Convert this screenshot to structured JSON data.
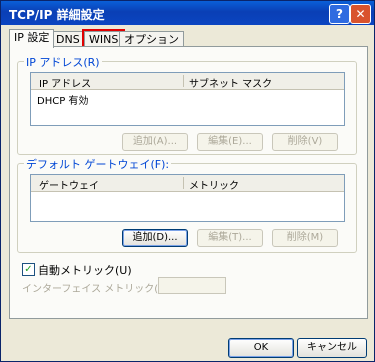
{
  "window": {
    "title": "TCP/IP 詳細設定",
    "help_icon": "?",
    "close_icon": "✕"
  },
  "tabs": [
    {
      "label": "IP 設定",
      "active": true
    },
    {
      "label": "DNS",
      "active": false
    },
    {
      "label": "WINS",
      "active": false,
      "highlighted": true
    },
    {
      "label": "オプション",
      "active": false
    }
  ],
  "ip_group": {
    "label": "IP アドレス(R)",
    "columns": [
      "IP アドレス",
      "サブネット マスク"
    ],
    "rows": [
      {
        "ip": "DHCP 有効",
        "mask": ""
      }
    ],
    "buttons": {
      "add": "追加(A)...",
      "edit": "編集(E)...",
      "delete": "削除(V)"
    }
  },
  "gw_group": {
    "label": "デフォルト ゲートウェイ(F):",
    "columns": [
      "ゲートウェイ",
      "メトリック"
    ],
    "rows": [],
    "buttons": {
      "add": "追加(D)...",
      "edit": "編集(T)...",
      "delete": "削除(M)"
    }
  },
  "auto_metric": {
    "label": "自動メトリック(U)",
    "checked": true,
    "check_mark": "✓"
  },
  "interface_metric": {
    "label": "インターフェイス メトリック(N):",
    "value": ""
  },
  "footer": {
    "ok": "OK",
    "cancel": "キャンセル"
  },
  "colors": {
    "title_bar": "#0a4fc8",
    "group_label": "#0046d5",
    "highlight": "#e00000"
  }
}
